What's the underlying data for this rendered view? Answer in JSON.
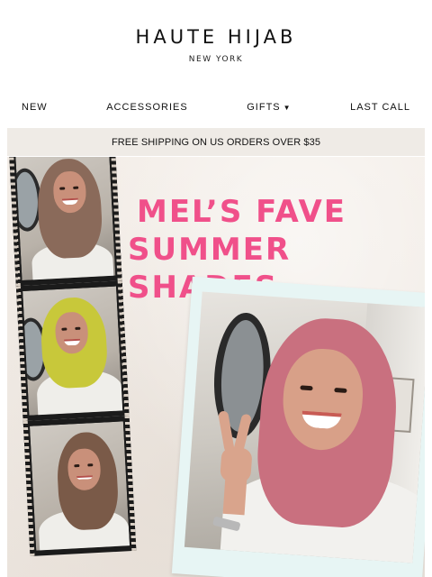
{
  "header": {
    "brand": "HAUTE HIJAB",
    "brand_sub": "NEW YORK"
  },
  "nav": {
    "items": [
      {
        "label": "NEW"
      },
      {
        "label": "ACCESSORIES"
      },
      {
        "label": "GIFTS",
        "has_dropdown": true,
        "icon": "chevron-down-icon"
      },
      {
        "label": "LAST CALL"
      }
    ]
  },
  "promo": {
    "shipping": "FREE SHIPPING ON US ORDERS OVER $35"
  },
  "hero": {
    "title_line1": "MEL’S FAVE",
    "title_line2": "SUMMER SHADES",
    "title_color": "#f0508a",
    "scarf_colors": [
      "#8a6a5a",
      "#c8c83a",
      "#7a5a48",
      "#c9707f"
    ]
  }
}
